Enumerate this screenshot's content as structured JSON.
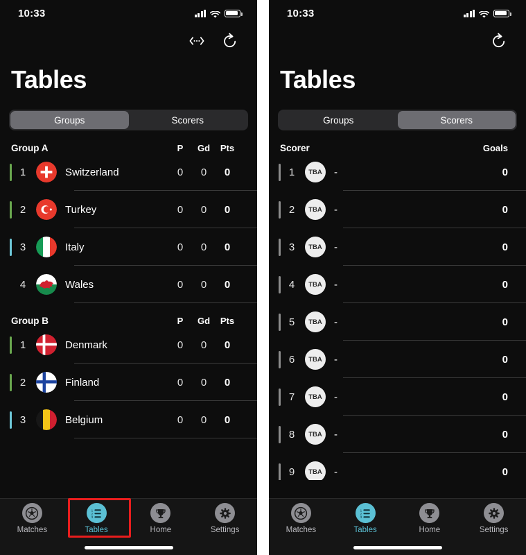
{
  "status_bar": {
    "time": "10:33",
    "signal_icon": "cellular-signal-icon",
    "wifi_icon": "wifi-icon",
    "battery_icon": "battery-icon"
  },
  "left_panel": {
    "nav_actions": [
      {
        "name": "swap-arrows-icon",
        "label": ""
      },
      {
        "name": "refresh-icon",
        "label": ""
      }
    ],
    "title": "Tables",
    "segments": [
      {
        "label": "Groups",
        "active": true
      },
      {
        "label": "Scorers",
        "active": false
      }
    ],
    "columns": {
      "p": "P",
      "gd": "Gd",
      "pts": "Pts"
    },
    "groups": [
      {
        "title": "Group A",
        "rows": [
          {
            "rank": "1",
            "team": "Switzerland",
            "flag": "switzerland",
            "p": "0",
            "gd": "0",
            "pts": "0",
            "bar": "green"
          },
          {
            "rank": "2",
            "team": "Turkey",
            "flag": "turkey",
            "p": "0",
            "gd": "0",
            "pts": "0",
            "bar": "green"
          },
          {
            "rank": "3",
            "team": "Italy",
            "flag": "italy",
            "p": "0",
            "gd": "0",
            "pts": "0",
            "bar": "cyan"
          },
          {
            "rank": "4",
            "team": "Wales",
            "flag": "wales",
            "p": "0",
            "gd": "0",
            "pts": "0",
            "bar": "none"
          }
        ]
      },
      {
        "title": "Group B",
        "rows": [
          {
            "rank": "1",
            "team": "Denmark",
            "flag": "denmark",
            "p": "0",
            "gd": "0",
            "pts": "0",
            "bar": "green"
          },
          {
            "rank": "2",
            "team": "Finland",
            "flag": "finland",
            "p": "0",
            "gd": "0",
            "pts": "0",
            "bar": "green"
          },
          {
            "rank": "3",
            "team": "Belgium",
            "flag": "belgium",
            "p": "0",
            "gd": "0",
            "pts": "0",
            "bar": "cyan"
          }
        ]
      }
    ]
  },
  "right_panel": {
    "nav_actions": [
      {
        "name": "refresh-icon",
        "label": ""
      }
    ],
    "title": "Tables",
    "segments": [
      {
        "label": "Groups",
        "active": false
      },
      {
        "label": "Scorers",
        "active": true
      }
    ],
    "columns": {
      "scorer": "Scorer",
      "goals": "Goals"
    },
    "scorers": [
      {
        "rank": "1",
        "avatar": "TBA",
        "name": "-",
        "goals": "0"
      },
      {
        "rank": "2",
        "avatar": "TBA",
        "name": "-",
        "goals": "0"
      },
      {
        "rank": "3",
        "avatar": "TBA",
        "name": "-",
        "goals": "0"
      },
      {
        "rank": "4",
        "avatar": "TBA",
        "name": "-",
        "goals": "0"
      },
      {
        "rank": "5",
        "avatar": "TBA",
        "name": "-",
        "goals": "0"
      },
      {
        "rank": "6",
        "avatar": "TBA",
        "name": "-",
        "goals": "0"
      },
      {
        "rank": "7",
        "avatar": "TBA",
        "name": "-",
        "goals": "0"
      },
      {
        "rank": "8",
        "avatar": "TBA",
        "name": "-",
        "goals": "0"
      },
      {
        "rank": "9",
        "avatar": "TBA",
        "name": "-",
        "goals": "0"
      }
    ]
  },
  "tab_bar": {
    "items": [
      {
        "label": "Matches",
        "icon": "soccer-ball-icon",
        "active": false
      },
      {
        "label": "Tables",
        "icon": "list-icon",
        "active": true
      },
      {
        "label": "Home",
        "icon": "trophy-icon",
        "active": false
      },
      {
        "label": "Settings",
        "icon": "gear-icon",
        "active": false
      }
    ]
  },
  "annotation": {
    "color": "#e81d1d",
    "target": "Tables"
  },
  "colors": {
    "accent": "#5bc0d4",
    "qualified": "#6aa84f",
    "playoff": "#6ec8d8",
    "background": "#0d0d0d",
    "segment_active": "#6d6d72"
  }
}
